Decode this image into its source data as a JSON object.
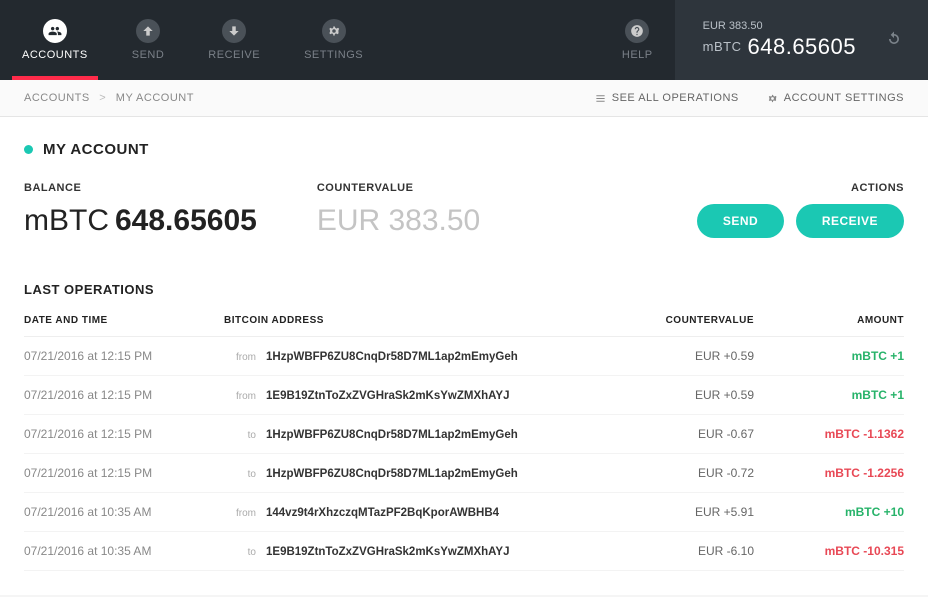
{
  "nav": {
    "items": [
      {
        "label": "ACCOUNTS",
        "icon": "users",
        "active": true
      },
      {
        "label": "SEND",
        "icon": "arrow-up",
        "active": false
      },
      {
        "label": "RECEIVE",
        "icon": "arrow-down",
        "active": false
      },
      {
        "label": "SETTINGS",
        "icon": "gear",
        "active": false
      }
    ],
    "help": {
      "label": "HELP",
      "icon": "question"
    }
  },
  "header_balance": {
    "countervalue_line": "EUR 383.50",
    "unit": "mBTC",
    "amount": "648.65605"
  },
  "breadcrumb": {
    "root": "ACCOUNTS",
    "sep": ">",
    "current": "MY ACCOUNT",
    "see_all": "SEE ALL OPERATIONS",
    "settings": "ACCOUNT SETTINGS"
  },
  "account": {
    "name": "MY ACCOUNT",
    "balance_label": "BALANCE",
    "balance_unit": "mBTC",
    "balance_value": "648.65605",
    "countervalue_label": "COUNTERVALUE",
    "countervalue_text": "EUR 383.50",
    "actions_label": "ACTIONS",
    "send_label": "SEND",
    "receive_label": "RECEIVE"
  },
  "operations": {
    "title": "LAST OPERATIONS",
    "columns": {
      "datetime": "DATE AND TIME",
      "address": "BITCOIN ADDRESS",
      "countervalue": "COUNTERVALUE",
      "amount": "AMOUNT"
    },
    "rows": [
      {
        "datetime": "07/21/2016 at 12:15 PM",
        "dir": "from",
        "address": "1HzpWBFP6ZU8CnqDr58D7ML1ap2mEmyGeh",
        "countervalue": "EUR +0.59",
        "amount": "mBTC +1",
        "sign": "pos"
      },
      {
        "datetime": "07/21/2016 at 12:15 PM",
        "dir": "from",
        "address": "1E9B19ZtnToZxZVGHraSk2mKsYwZMXhAYJ",
        "countervalue": "EUR +0.59",
        "amount": "mBTC +1",
        "sign": "pos"
      },
      {
        "datetime": "07/21/2016 at 12:15 PM",
        "dir": "to",
        "address": "1HzpWBFP6ZU8CnqDr58D7ML1ap2mEmyGeh",
        "countervalue": "EUR -0.67",
        "amount": "mBTC -1.1362",
        "sign": "neg"
      },
      {
        "datetime": "07/21/2016 at 12:15 PM",
        "dir": "to",
        "address": "1HzpWBFP6ZU8CnqDr58D7ML1ap2mEmyGeh",
        "countervalue": "EUR -0.72",
        "amount": "mBTC -1.2256",
        "sign": "neg"
      },
      {
        "datetime": "07/21/2016 at 10:35 AM",
        "dir": "from",
        "address": "144vz9t4rXhzczqMTazPF2BqKporAWBHB4",
        "countervalue": "EUR +5.91",
        "amount": "mBTC +10",
        "sign": "pos"
      },
      {
        "datetime": "07/21/2016 at 10:35 AM",
        "dir": "to",
        "address": "1E9B19ZtnToZxZVGHraSk2mKsYwZMXhAYJ",
        "countervalue": "EUR -6.10",
        "amount": "mBTC -10.315",
        "sign": "neg"
      }
    ]
  }
}
